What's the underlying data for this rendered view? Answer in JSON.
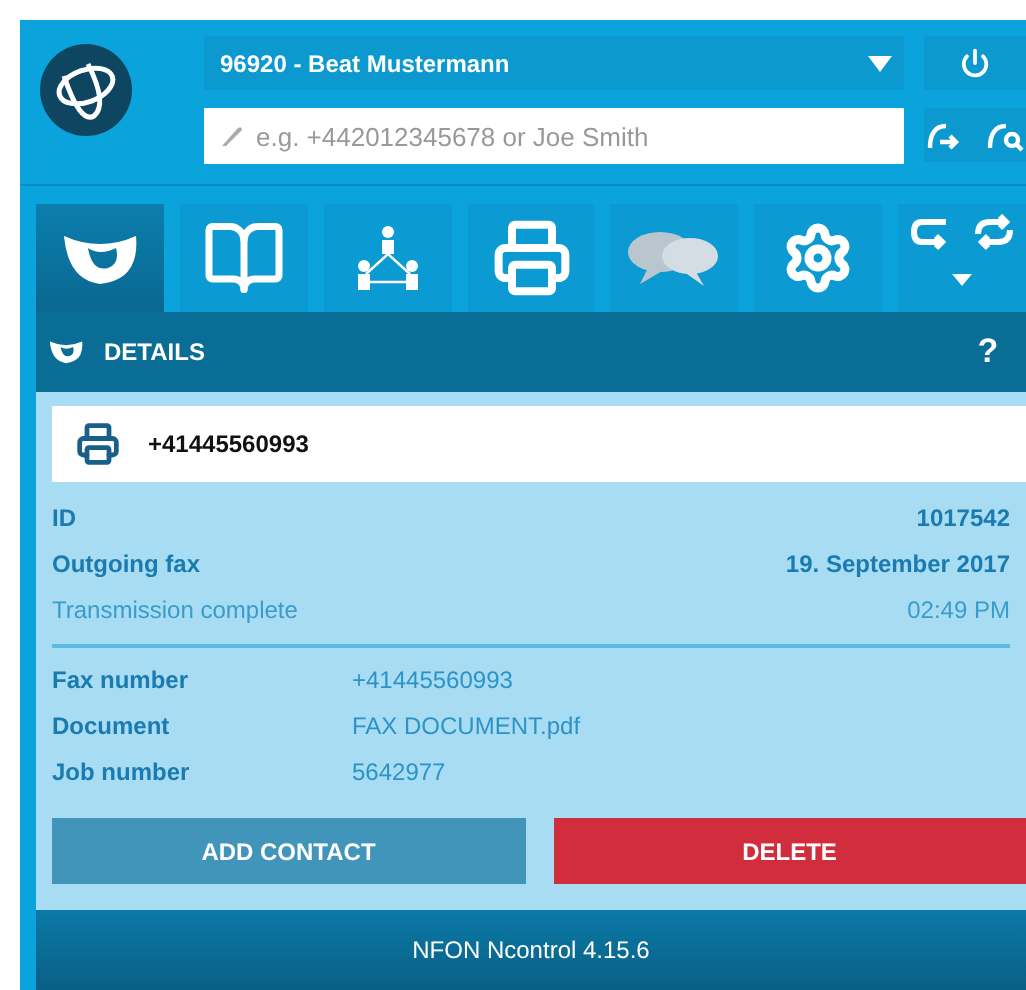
{
  "account": {
    "label": "96920 - Beat Mustermann"
  },
  "search": {
    "placeholder": "e.g. +442012345678 or Joe Smith"
  },
  "tabs": [
    {
      "kind": "calls",
      "selected": true
    },
    {
      "kind": "contacts",
      "selected": false
    },
    {
      "kind": "team",
      "selected": false
    },
    {
      "kind": "fax",
      "selected": false
    },
    {
      "kind": "messages",
      "selected": false
    },
    {
      "kind": "settings",
      "selected": false
    },
    {
      "kind": "forwarding",
      "selected": false
    }
  ],
  "details": {
    "title": "DETAILS",
    "help": "?"
  },
  "fax_card": {
    "number": "+41445560993"
  },
  "summary": [
    {
      "label": "ID",
      "value": "1017542",
      "kind": "strong"
    },
    {
      "label": "Outgoing fax",
      "value": "19. September 2017",
      "kind": "strong"
    },
    {
      "label": "Transmission complete",
      "value": "02:49 PM",
      "kind": "light"
    }
  ],
  "fields": [
    {
      "label": "Fax number",
      "value": "+41445560993"
    },
    {
      "label": "Document",
      "value": "FAX DOCUMENT.pdf"
    },
    {
      "label": "Job number",
      "value": "5642977"
    }
  ],
  "buttons": [
    {
      "label": "ADD CONTACT",
      "kind": "secondary"
    },
    {
      "label": "DELETE",
      "kind": "danger"
    }
  ],
  "footer": "NFON Ncontrol 4.15.6"
}
